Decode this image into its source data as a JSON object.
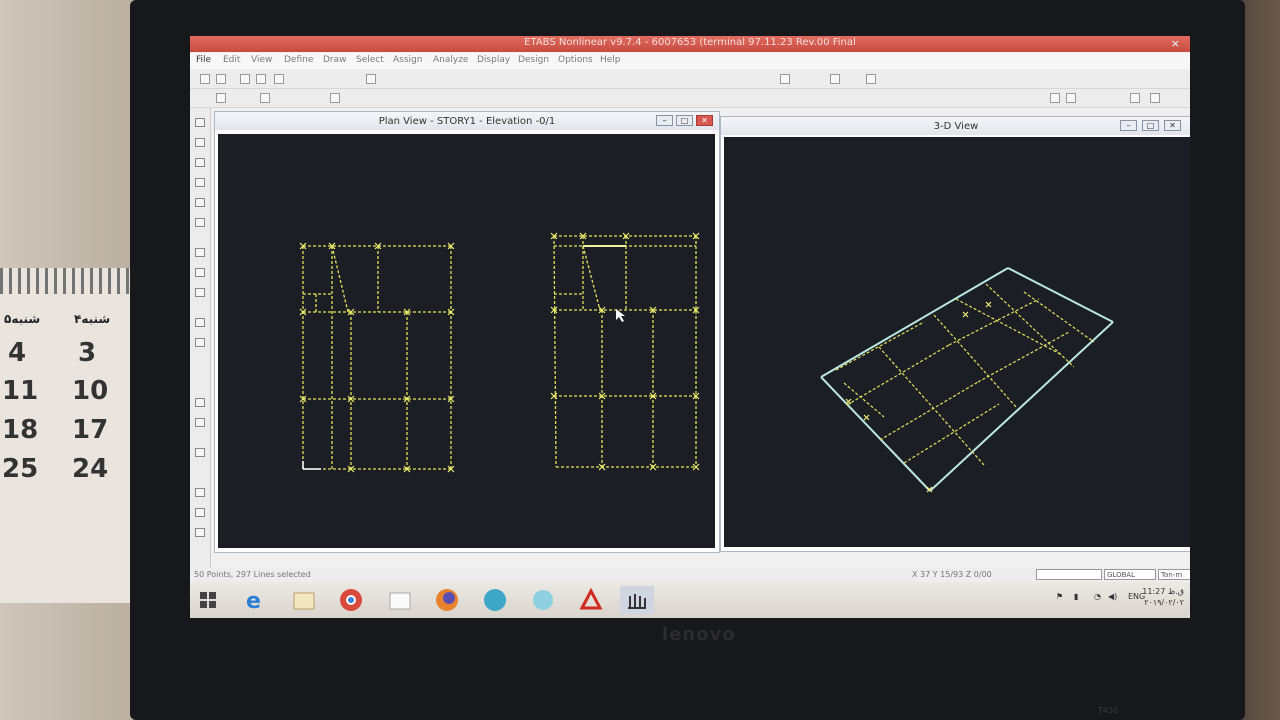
{
  "app": {
    "title": "ETABS Nonlinear v9.7.4 - 6007653 (terminal 97.11.23 Rev.00 Final",
    "close_glyph": "×"
  },
  "menu": [
    "File",
    "Edit",
    "View",
    "Define",
    "Draw",
    "Select",
    "Assign",
    "Analyze",
    "Display",
    "Design",
    "Options",
    "Help"
  ],
  "plan_window": {
    "title": "Plan View - STORY1 - Elevation -0/1"
  },
  "view3d_window": {
    "title": "3-D View"
  },
  "window_buttons": {
    "minimize": "–",
    "maximize": "□",
    "close": "✕"
  },
  "status": {
    "left": "50 Points, 297 Lines selected",
    "coords": "X 37 Y 15/93 Z 0/00",
    "coord_system": "GLOBAL",
    "units": "Ton-m"
  },
  "taskbar": {
    "apps": [
      "windows-start",
      "internet-explorer",
      "file-explorer",
      "chrome",
      "blank-window",
      "firefox",
      "app-blue",
      "app-cyan",
      "acrobat",
      "etabs"
    ],
    "language": "ENG",
    "time": "ق.ظ 11:27",
    "date": "۲۰۱۹/۰۲/۰۲"
  },
  "calendar": {
    "headers": [
      "۵شنبه",
      "۴شنبه"
    ],
    "days": [
      [
        "4",
        "3"
      ],
      [
        "11",
        "10"
      ],
      [
        "18",
        "17"
      ],
      [
        "25",
        "24"
      ]
    ]
  },
  "laptop": {
    "brand": "lenovo",
    "model": "T430"
  },
  "colors": {
    "titlebar": "#c84a40",
    "canvas": "#1b1e25",
    "grid_line": "#e6e35a",
    "frame_line": "#b8e8e0"
  }
}
